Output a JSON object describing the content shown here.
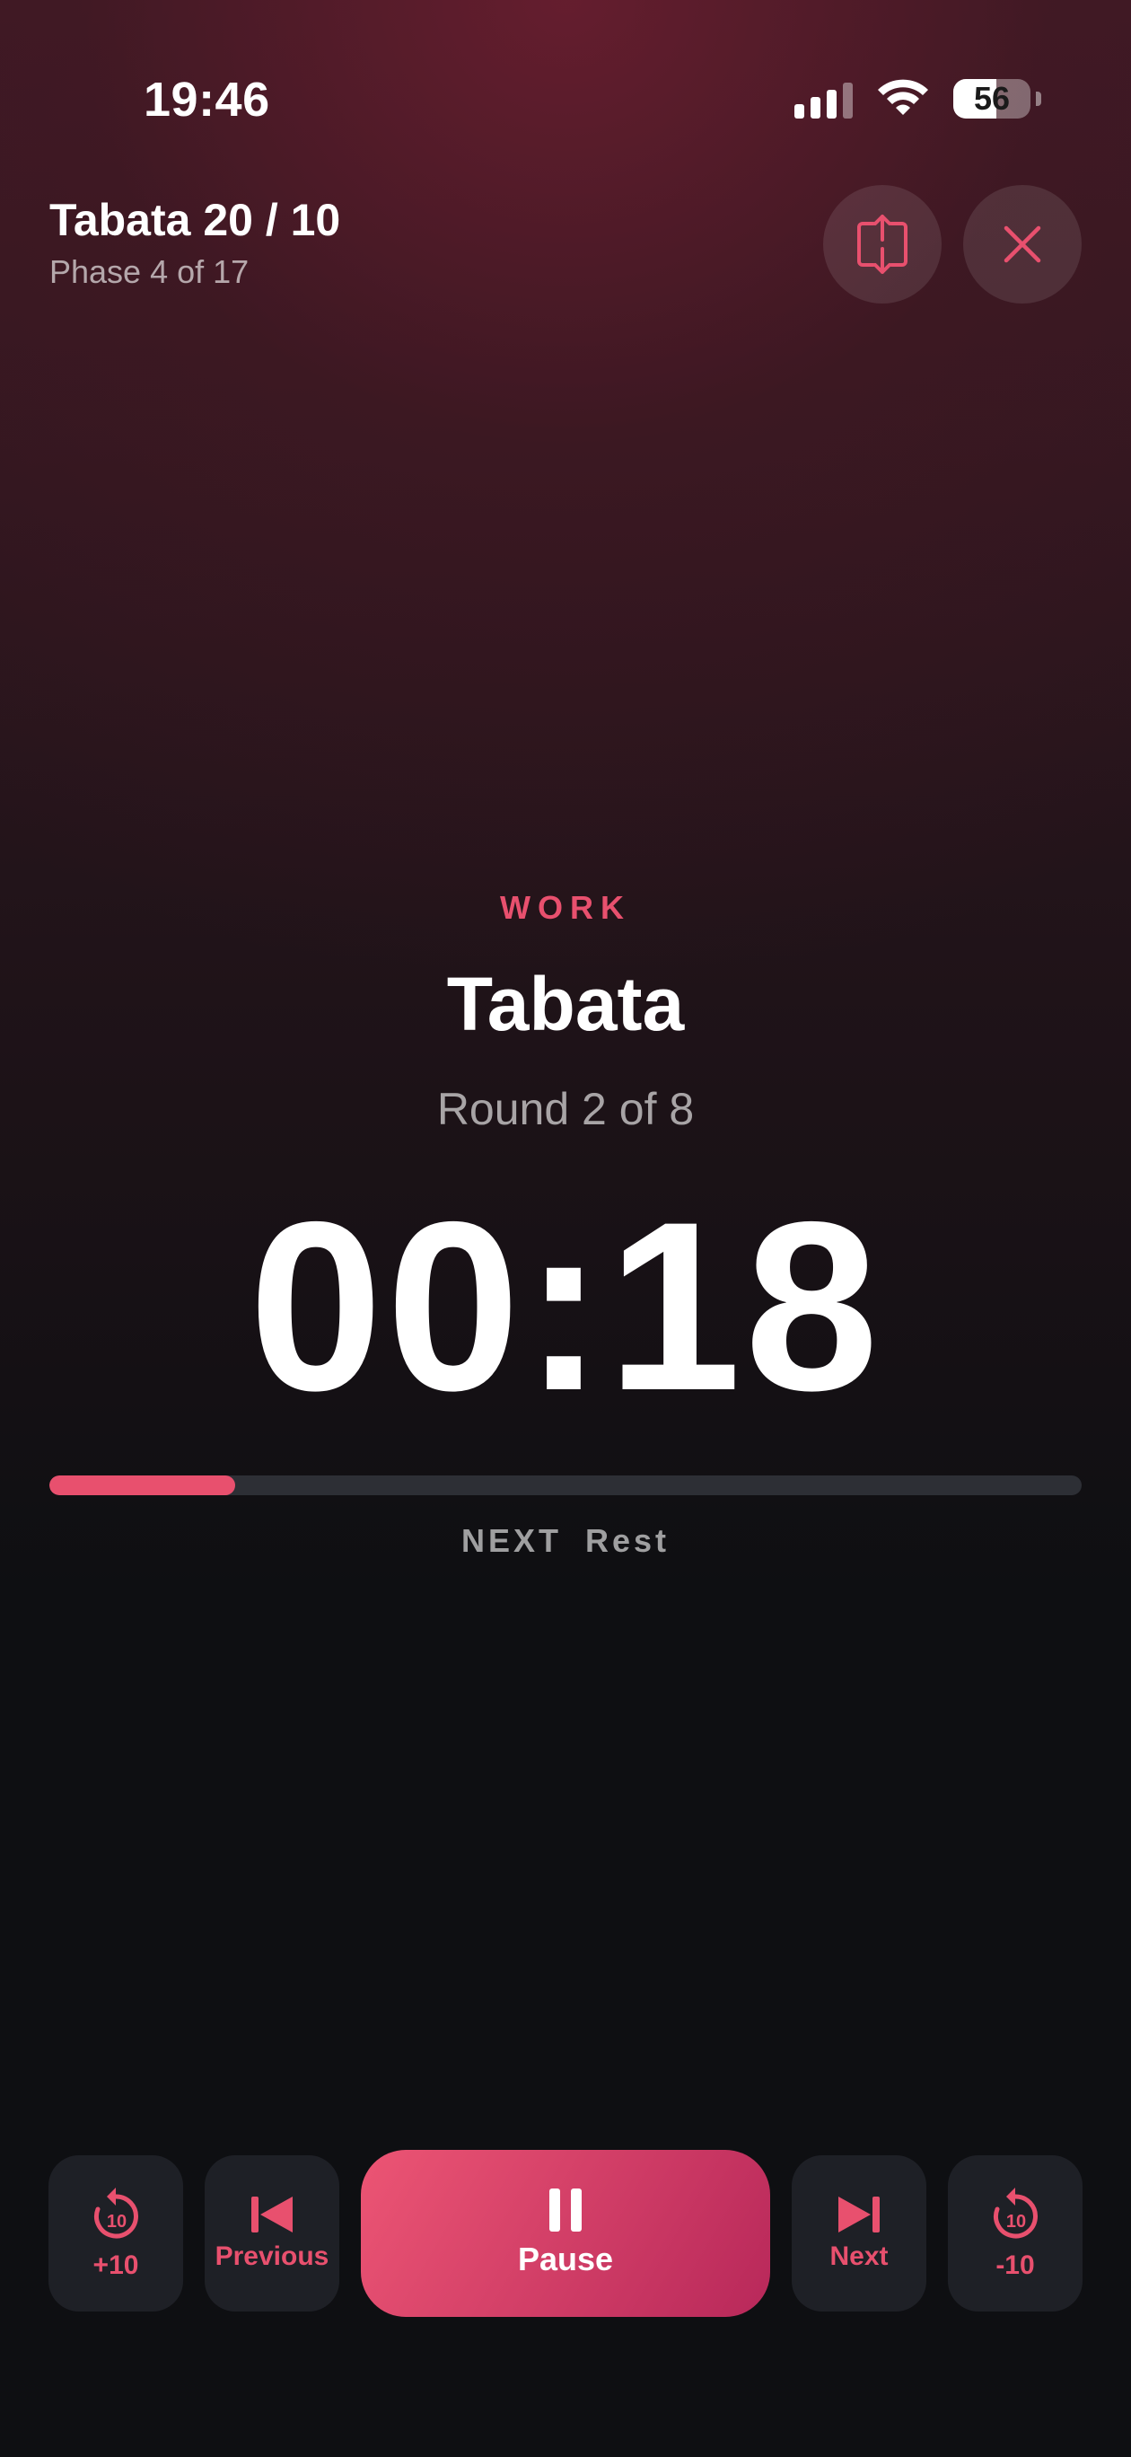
{
  "status_bar": {
    "time": "19:46",
    "battery": "56",
    "battery_level": 0.56
  },
  "header": {
    "title": "Tabata 20 / 10",
    "subtitle": "Phase 4 of 17"
  },
  "phase": {
    "type": "WORK",
    "name": "Tabata",
    "round": "Round 2 of 8",
    "time_remaining": "00:18",
    "progress": 0.18
  },
  "next": {
    "label": "NEXT",
    "value": "Rest"
  },
  "controls": {
    "plus10": "+10",
    "previous": "Previous",
    "pause": "Pause",
    "next": "Next",
    "minus10": "-10",
    "skip_icon_text": "10"
  },
  "colors": {
    "accent": "#e8506e",
    "background": "#0e0f12"
  }
}
